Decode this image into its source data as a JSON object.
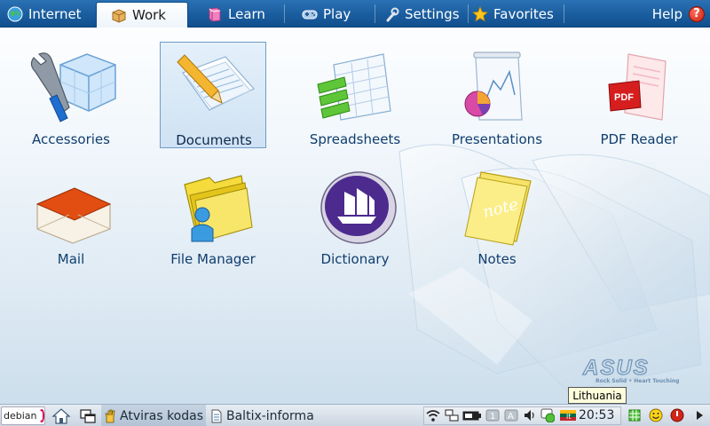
{
  "tabs": [
    {
      "label": "Internet",
      "icon": "globe-icon"
    },
    {
      "label": "Work",
      "icon": "briefcase-icon",
      "active": true
    },
    {
      "label": "Learn",
      "icon": "book-icon"
    },
    {
      "label": "Play",
      "icon": "gamepad-icon"
    },
    {
      "label": "Settings",
      "icon": "wrench-icon"
    },
    {
      "label": "Favorites",
      "icon": "star-icon"
    }
  ],
  "help": {
    "label": "Help",
    "icon": "question-icon"
  },
  "apps": [
    {
      "label": "Accessories",
      "icon": "accessories-icon"
    },
    {
      "label": "Documents",
      "icon": "documents-icon",
      "selected": true
    },
    {
      "label": "Spreadsheets",
      "icon": "spreadsheets-icon"
    },
    {
      "label": "Presentations",
      "icon": "presentations-icon"
    },
    {
      "label": "PDF Reader",
      "icon": "pdf-reader-icon",
      "badge": "PDF"
    },
    {
      "label": "Mail",
      "icon": "mail-icon"
    },
    {
      "label": "File Manager",
      "icon": "file-manager-icon"
    },
    {
      "label": "Dictionary",
      "icon": "dictionary-icon"
    },
    {
      "label": "Notes",
      "icon": "notes-icon",
      "badge": "note"
    }
  ],
  "brand": {
    "name": "ASUS",
    "tagline": "Rock Solid • Heart Touching"
  },
  "tooltip": "Lithuania",
  "taskbar": {
    "start_label": "debian",
    "tasks": [
      {
        "label": "Atviras kodas",
        "icon": "hand-icon"
      },
      {
        "label": "Baltix-informa",
        "icon": "document-icon"
      }
    ],
    "clock": "20:53",
    "keyboard_layout": "lt"
  },
  "colors": {
    "tabbar": "#1a5d9f",
    "label": "#103e6e",
    "selection": "#cfe2f3"
  }
}
